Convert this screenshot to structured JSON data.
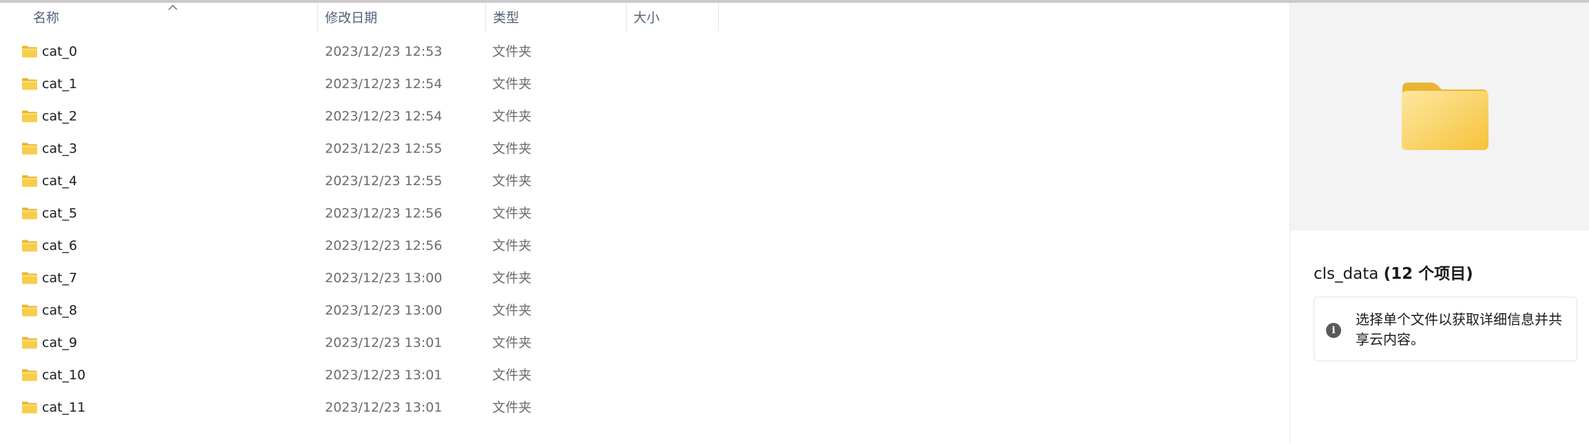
{
  "columns": {
    "name": "名称",
    "date": "修改日期",
    "type": "类型",
    "size": "大小"
  },
  "files": [
    {
      "name": "cat_0",
      "date": "2023/12/23 12:53",
      "type": "文件夹"
    },
    {
      "name": "cat_1",
      "date": "2023/12/23 12:54",
      "type": "文件夹"
    },
    {
      "name": "cat_2",
      "date": "2023/12/23 12:54",
      "type": "文件夹"
    },
    {
      "name": "cat_3",
      "date": "2023/12/23 12:55",
      "type": "文件夹"
    },
    {
      "name": "cat_4",
      "date": "2023/12/23 12:55",
      "type": "文件夹"
    },
    {
      "name": "cat_5",
      "date": "2023/12/23 12:56",
      "type": "文件夹"
    },
    {
      "name": "cat_6",
      "date": "2023/12/23 12:56",
      "type": "文件夹"
    },
    {
      "name": "cat_7",
      "date": "2023/12/23 13:00",
      "type": "文件夹"
    },
    {
      "name": "cat_8",
      "date": "2023/12/23 13:00",
      "type": "文件夹"
    },
    {
      "name": "cat_9",
      "date": "2023/12/23 13:01",
      "type": "文件夹"
    },
    {
      "name": "cat_10",
      "date": "2023/12/23 13:01",
      "type": "文件夹"
    },
    {
      "name": "cat_11",
      "date": "2023/12/23 13:01",
      "type": "文件夹"
    }
  ],
  "details": {
    "folder_name": "cls_data",
    "item_count": "(12 个项目)",
    "info_message": "选择单个文件以获取详细信息并共享云内容。",
    "info_icon": "i"
  },
  "colors": {
    "folder_yellow": "#f8cd4b",
    "folder_back": "#e9b532",
    "header_text": "#52607a"
  }
}
